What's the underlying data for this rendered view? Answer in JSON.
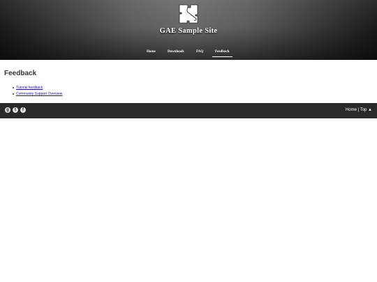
{
  "header": {
    "site_title": "GAE Sample Site",
    "logo_icon": "puzzle-piece-icon",
    "background_color": "#4a4a4a"
  },
  "nav": {
    "items": [
      {
        "label": "Home"
      },
      {
        "label": "Downloads"
      },
      {
        "label": "FAQ"
      },
      {
        "label": "Feedback",
        "active": true
      }
    ]
  },
  "main": {
    "heading": "Feedback",
    "links": [
      {
        "label": "Tutorial feedback"
      },
      {
        "label": "Community Support Overview"
      }
    ],
    "link_color": "#1a0dab"
  },
  "footer": {
    "social_icons": [
      "google-plus-icon",
      "twitter-icon",
      "facebook-icon"
    ],
    "home_label": "Home",
    "separator": "|",
    "top_label": "Top ▲",
    "background_color": "#2a2a2a"
  }
}
